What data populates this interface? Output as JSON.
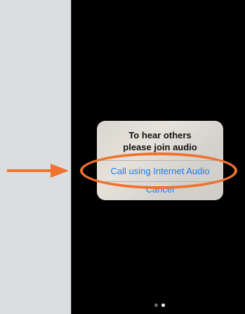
{
  "dialog": {
    "title": "To hear others\nplease join audio",
    "action_label": "Call using Internet Audio",
    "cancel_label": "Cancel"
  },
  "annotation": {
    "highlight_color": "#f0722f",
    "arrow_color": "#f0722f"
  },
  "page_indicator": {
    "count": 2,
    "current": 2
  },
  "colors": {
    "screen_background": "#000000",
    "side_background": "#dcdddf",
    "link_blue": "#1a7cf4"
  }
}
